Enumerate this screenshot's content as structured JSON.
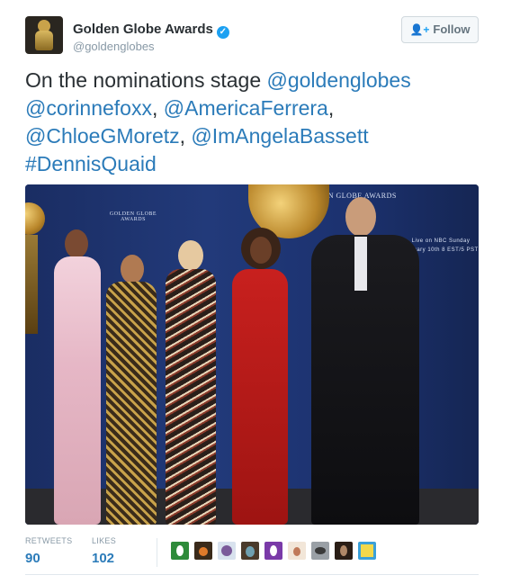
{
  "account": {
    "name": "Golden Globe Awards",
    "handle": "@goldenglobes",
    "verified_glyph": "✓",
    "avatar_icon": "golden-globe-statue-icon"
  },
  "follow_button": {
    "label": "Follow",
    "icon": "add-user-icon"
  },
  "tweet": {
    "text_plain": "On the nominations stage ",
    "mention_1": "@goldenglobes",
    "mention_2": "@corinnefoxx",
    "sep_1": ", ",
    "mention_3": "@AmericaFerrera",
    "sep_2": ",",
    "mention_4": "@ChloeGMoretz",
    "sep_3": ", ",
    "mention_5": "@ImAngelaBassett",
    "hashtag": "#DennisQuaid"
  },
  "photo": {
    "description_icon": "nominations-stage-photo",
    "backdrop_text_1": "GOLDEN GLOBE AWARDS",
    "backdrop_text_2": "Live on NBC Sunday",
    "backdrop_text_3": "January 10th 8 EST/5 PST"
  },
  "stats": {
    "retweets_label": "RETWEETS",
    "retweets_value": "90",
    "likes_label": "LIKES",
    "likes_value": "102"
  },
  "colors": {
    "link": "#2b7bb9",
    "verified": "#1da1f2",
    "muted": "#8899a6"
  }
}
